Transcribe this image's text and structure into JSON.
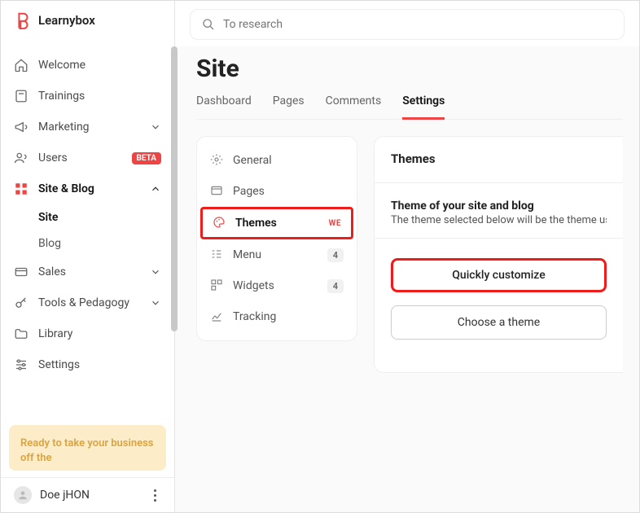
{
  "brand": "Learnybox",
  "search": {
    "placeholder": "To research"
  },
  "nav": {
    "welcome": "Welcome",
    "trainings": "Trainings",
    "marketing": "Marketing",
    "users": "Users",
    "users_badge": "BETA",
    "siteblog": "Site & Blog",
    "site": "Site",
    "blog": "Blog",
    "sales": "Sales",
    "tools": "Tools & Pedagogy",
    "library": "Library",
    "settings": "Settings"
  },
  "promo": "Ready to take your business off the",
  "user": {
    "name": "Doe jHON"
  },
  "page": {
    "title": "Site",
    "tabs": {
      "dashboard": "Dashboard",
      "pages": "Pages",
      "comments": "Comments",
      "settings": "Settings"
    }
  },
  "settings_menu": {
    "general": "General",
    "pages": "Pages",
    "themes": "Themes",
    "themes_tag": "WE",
    "menu": "Menu",
    "menu_count": "4",
    "widgets": "Widgets",
    "widgets_count": "4",
    "tracking": "Tracking"
  },
  "themes": {
    "heading": "Themes",
    "subheading": "Theme of your site and blog",
    "desc": "The theme selected below will be the theme used",
    "quickly": "Quickly customize",
    "choose": "Choose a theme"
  }
}
